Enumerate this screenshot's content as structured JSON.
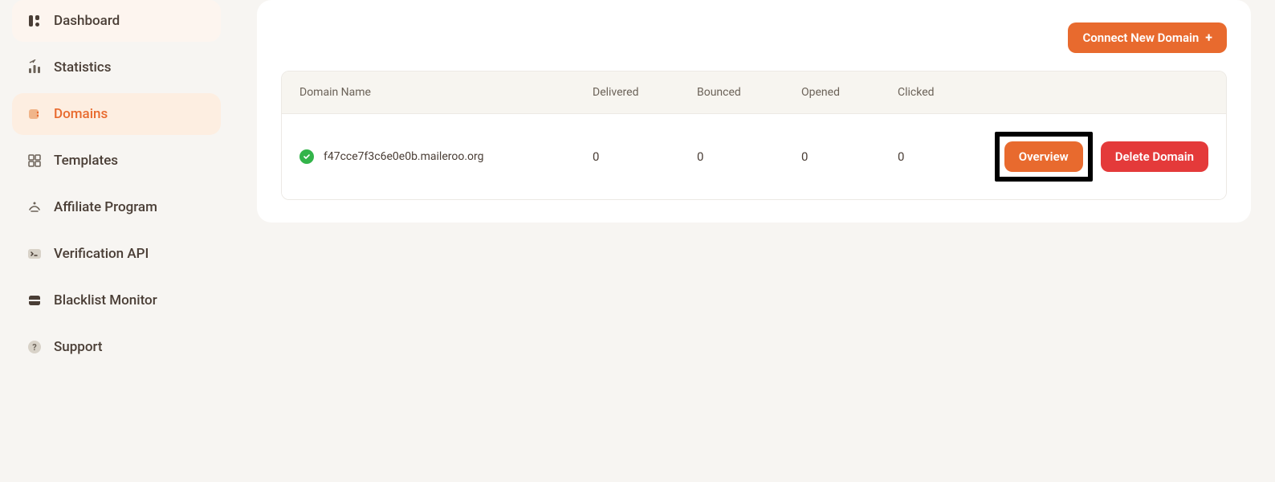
{
  "sidebar": {
    "items": [
      {
        "label": "Dashboard"
      },
      {
        "label": "Statistics"
      },
      {
        "label": "Domains"
      },
      {
        "label": "Templates"
      },
      {
        "label": "Affiliate Program"
      },
      {
        "label": "Verification API"
      },
      {
        "label": "Blacklist Monitor"
      },
      {
        "label": "Support"
      }
    ]
  },
  "header": {
    "connect_button": "Connect New Domain"
  },
  "table": {
    "headers": {
      "name": "Domain Name",
      "delivered": "Delivered",
      "bounced": "Bounced",
      "opened": "Opened",
      "clicked": "Clicked"
    },
    "rows": [
      {
        "name": "f47cce7f3c6e0e0b.maileroo.org",
        "delivered": "0",
        "bounced": "0",
        "opened": "0",
        "clicked": "0",
        "overview_label": "Overview",
        "delete_label": "Delete Domain"
      }
    ]
  }
}
